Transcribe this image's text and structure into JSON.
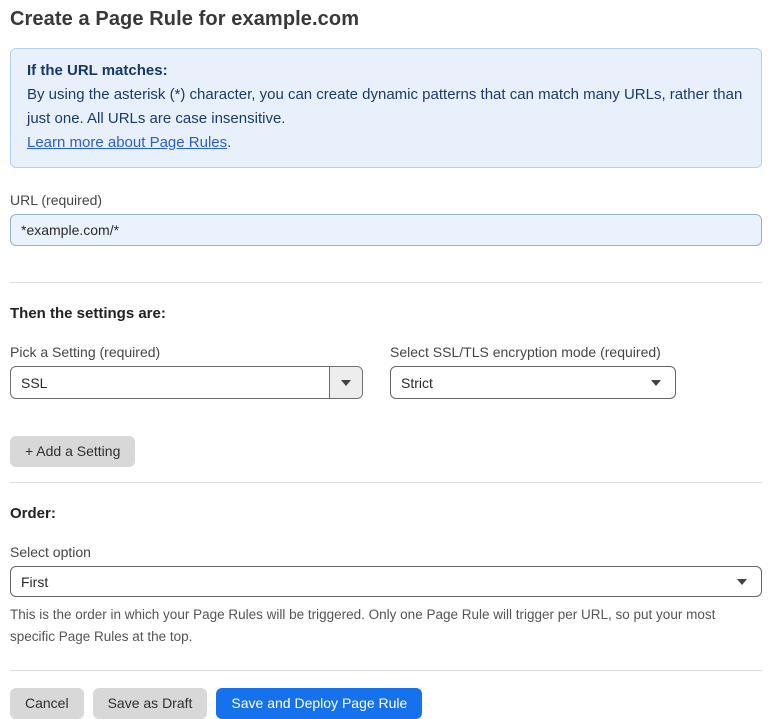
{
  "page": {
    "title": "Create a Page Rule for example.com"
  },
  "info_box": {
    "heading": "If the URL matches:",
    "body": "By using the asterisk (*) character, you can create dynamic patterns that can match many URLs, rather than just one. All URLs are case insensitive.",
    "link_label": "Learn more about Page Rules",
    "link_suffix": "."
  },
  "url_field": {
    "label": "URL (required)",
    "value": "*example.com/*"
  },
  "settings_section": {
    "heading": "Then the settings are:",
    "setting_select": {
      "label": "Pick a Setting (required)",
      "value": "SSL"
    },
    "mode_select": {
      "label": "Select SSL/TLS encryption mode (required)",
      "value": "Strict"
    },
    "add_setting_label": "+ Add a Setting"
  },
  "order_section": {
    "heading": "Order:",
    "select_label": "Select option",
    "select_value": "First",
    "help_text": "This is the order in which your Page Rules will be triggered. Only one Page Rule will trigger per URL, so put your most specific Page Rules at the top."
  },
  "footer": {
    "cancel_label": "Cancel",
    "save_draft_label": "Save as Draft",
    "save_deploy_label": "Save and Deploy Page Rule"
  },
  "colors": {
    "accent_blue": "#1672ec",
    "info_bg": "#e8f1fb",
    "info_border": "#b3d1ef",
    "info_text": "#1b3a70",
    "link_blue": "#2a5fd0",
    "input_bg": "#e9f2fd"
  }
}
